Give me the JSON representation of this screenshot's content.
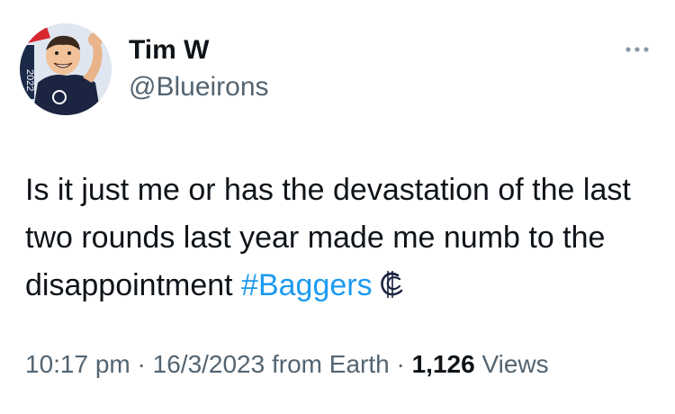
{
  "tweet": {
    "author_name": "Tim W",
    "author_handle": "@Blueirons",
    "avatar_icon": "caricature-avatar",
    "avatar_text": "2022",
    "more_icon": "more-horizontal-icon",
    "text_before_hashtag": "Is it just me or has the devastation of the last two rounds last year made me numb to the disappointment ",
    "hashtag": "#Baggers",
    "hashtag_emoji": "carlton-logo-emoji",
    "time": "10:17 pm",
    "separator": " · ",
    "date": "16/3/2023",
    "source": " from Earth",
    "views_count": "1,126",
    "views_label": " Views",
    "colors": {
      "text": "#0f1419",
      "secondary": "#536471",
      "link": "#1d9bf0",
      "background": "#ffffff"
    }
  }
}
